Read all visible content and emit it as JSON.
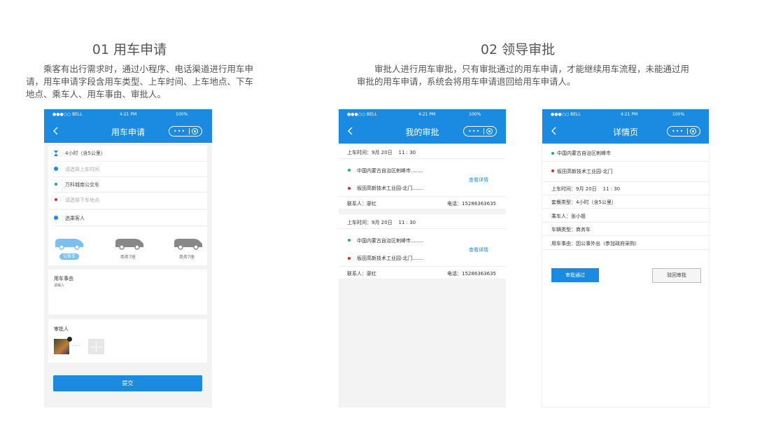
{
  "section1": {
    "title": "01 用车申请",
    "desc": "乘客有出行需求时，通过小程序、电话渠道进行用车申请，用车申请字段含用车类型、上车时间、上车地点、下车地点、乘车人、用车事由、审批人。"
  },
  "section2": {
    "title": "02 领导审批",
    "desc": "审批人进行用车审批，只有审批通过的用车申请，才能继续用车流程，未能通过用审批的用车申请，系统会将用车申请退回给用车申请人。"
  },
  "status": {
    "carrier": "●●●○○ BELL",
    "time": "4:21 PM",
    "battery": "100%"
  },
  "capsule": {
    "dots": "•••"
  },
  "phone1": {
    "title": "用车申请",
    "package": "4小时（含5公里）",
    "time_placeholder": "请选择上车时间",
    "start": "万科城南公交车",
    "end_placeholder": "请选择下车地点",
    "passenger": "选乘客人",
    "cars": [
      {
        "label": "公务车",
        "selected": true
      },
      {
        "label": "商务7座",
        "selected": false
      },
      {
        "label": "商务7座",
        "selected": false
      }
    ],
    "reason_label": "用车事由",
    "reason_placeholder": "请输入",
    "approver_label": "审批人",
    "more": "· · ·",
    "submit": "提交"
  },
  "phone2": {
    "title": "我的审批",
    "items": [
      {
        "time": "上车时间：9月 20日    11 : 30",
        "from": "中国内蒙古自治区剌峰市........",
        "to": "坂田高新技术工业园-北门.......",
        "detail": "查看详情",
        "contact": "联系人：廖红",
        "phone": "电话：15286363635"
      },
      {
        "time": "上车时间：9月 20日    11 : 30",
        "from": "中国内蒙古自治区剌峰市........",
        "to": "坂田高新技术工业园-北门.......",
        "detail": "查看详情",
        "contact": "联系人：廖红",
        "phone": "电话：15286363635"
      }
    ]
  },
  "phone3": {
    "title": "详情页",
    "from": "中国内蒙古自治区剌峰市",
    "to": "坂田高新技术工业园-北门",
    "time": "上车时间：9月 20日    11 : 30",
    "package": "套餐类型：4小时（含5公里）",
    "passenger": "乘车人：张小姐",
    "vehicle": "车辆类型：商务车",
    "reason": "用车事由：因公事外出（参加政府采购）",
    "approve": "审批通过",
    "reject": "驳回审批"
  },
  "colors": {
    "primary": "#1a8be0",
    "green": "#1bb06b",
    "red": "#e0262b"
  }
}
